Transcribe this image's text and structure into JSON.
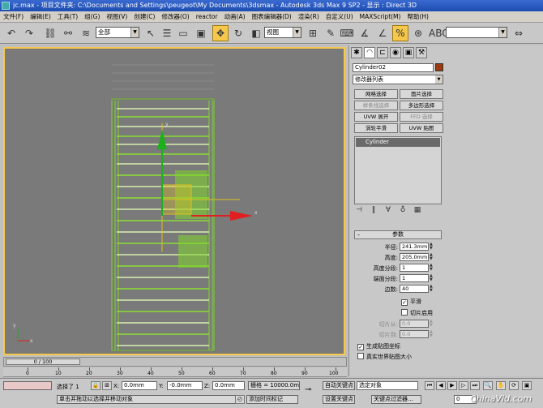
{
  "window": {
    "title": "jc.max - 项目文件夹: C:\\Documents and Settings\\peugeot\\My Documents\\3dsmax - Autodesk 3ds Max 9 SP2 - 显示 : Direct 3D"
  },
  "menu": [
    "文件(F)",
    "编辑(E)",
    "工具(T)",
    "组(G)",
    "视图(V)",
    "创建(C)",
    "修改器(O)",
    "reactor",
    "动画(A)",
    "图表编辑器(D)",
    "渲染(R)",
    "自定义(U)",
    "MAXScript(M)",
    "帮助(H)"
  ],
  "toolbar": {
    "selection_filter": "全部",
    "ref_coord": "视图",
    "named_sel": ""
  },
  "viewport": {
    "label": ""
  },
  "command_panel": {
    "object_name": "Cylinder02",
    "object_color": "#9a3a10",
    "modifier_list": "修改器列表",
    "buttons": [
      {
        "label": "网格选择",
        "enabled": true
      },
      {
        "label": "面片选择",
        "enabled": true
      },
      {
        "label": "样条线选择",
        "enabled": false
      },
      {
        "label": "多边形选择",
        "enabled": true
      },
      {
        "label": "UVW 展开",
        "enabled": true
      },
      {
        "label": "FFD 选择",
        "enabled": false
      },
      {
        "label": "涡轮平滑",
        "enabled": true
      },
      {
        "label": "UVW 贴图",
        "enabled": true
      }
    ],
    "stack_item": "Cylinder",
    "rollout_title": "参数",
    "params": [
      {
        "label": "半径:",
        "value": "241.3mm",
        "enabled": true
      },
      {
        "label": "高度:",
        "value": "205.0mm",
        "enabled": true
      },
      {
        "label": "高度分段:",
        "value": "1",
        "enabled": true
      },
      {
        "label": "端面分段:",
        "value": "1",
        "enabled": true
      },
      {
        "label": "边数:",
        "value": "40",
        "enabled": true
      }
    ],
    "smooth_label": "平滑",
    "smooth_checked": "✓",
    "slice_on_label": "切片启用",
    "slice_params": [
      {
        "label": "切片从:",
        "value": "0.0"
      },
      {
        "label": "切片到:",
        "value": "0.0"
      }
    ],
    "gen_map_label": "生成贴图坐标",
    "gen_map_checked": "✓",
    "real_world_label": "真实世界贴图大小"
  },
  "timeline": {
    "slider_label": "0 / 100",
    "ticks": [
      "0",
      "10",
      "20",
      "30",
      "40",
      "50",
      "60",
      "70",
      "80",
      "90",
      "100"
    ]
  },
  "status": {
    "selected": "选择了 1",
    "x_label": "X:",
    "x_value": "0.0mm",
    "y_label": "Y:",
    "y_value": "-0.0mm",
    "z_label": "Z:",
    "z_value": "0.0mm",
    "grid": "栅格 = 10000.0m",
    "prompt": "单击并拖动以选择并移动对象",
    "add_time_tag": "添加时间标记",
    "auto_key": "自动关键点",
    "set_key": "设置关键点",
    "sel_obj": "选定对象",
    "key_filter": "关键点过滤器...",
    "frame": "0"
  },
  "watermark": "ChinaVid.com"
}
